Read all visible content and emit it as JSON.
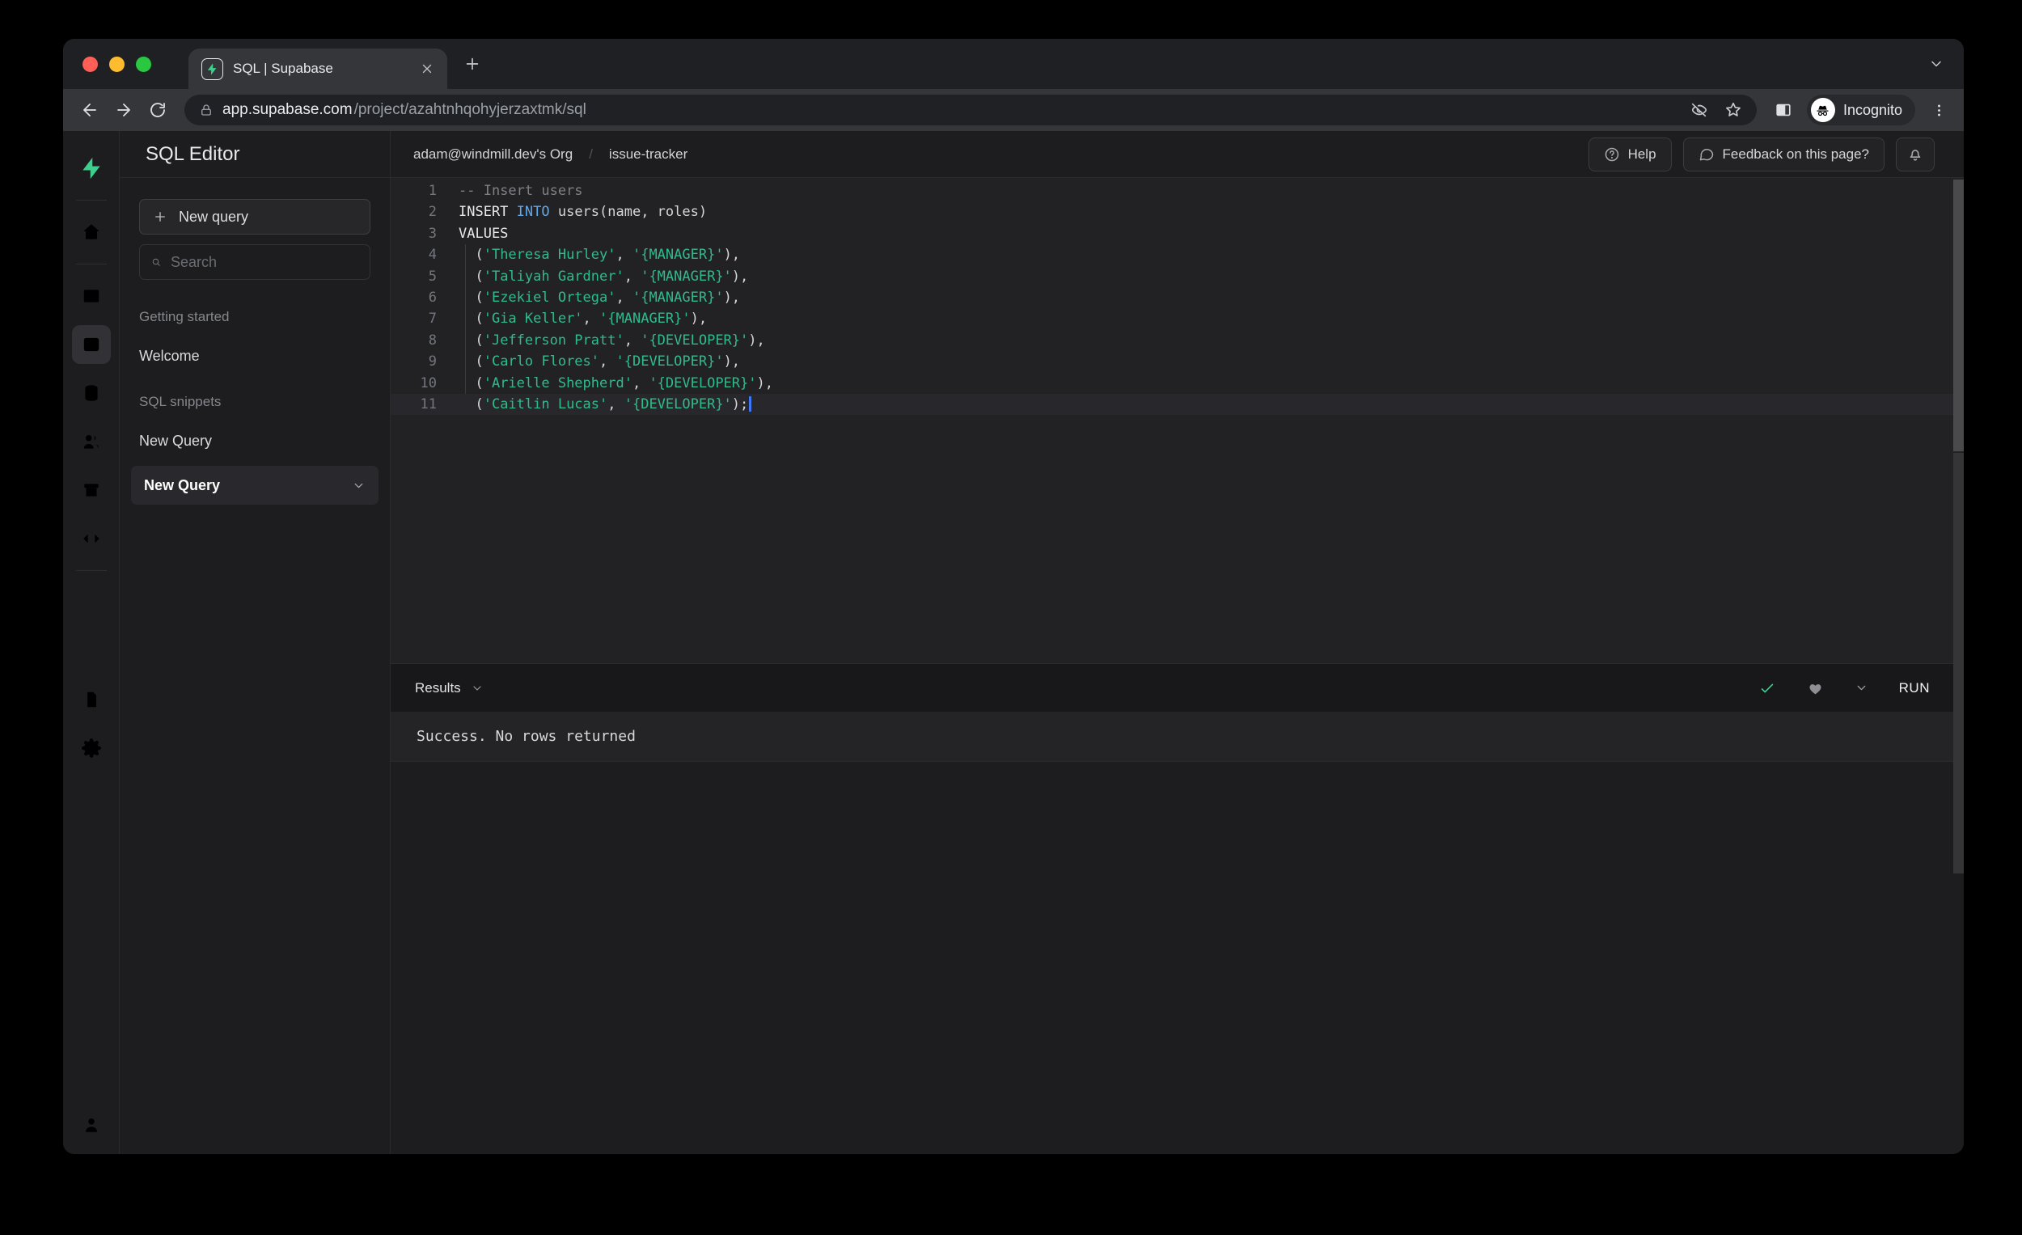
{
  "colors": {
    "brand_green": "#3ecf8e",
    "keyword_blue": "#61a8e8",
    "string_green": "#2fbc8b",
    "success_check": "#3ecf8e",
    "cursor_blue": "#3e78f2"
  },
  "browser": {
    "tab": {
      "title": "SQL | Supabase"
    },
    "url": {
      "host": "app.supabase.com",
      "path": "/project/azahtnhqohyjerzaxtmk/sql"
    },
    "incognito_label": "Incognito"
  },
  "header": {
    "app_title": "SQL Editor",
    "breadcrumb": {
      "org": "adam@windmill.dev's Org",
      "separator": "/",
      "project": "issue-tracker"
    },
    "help_label": "Help",
    "feedback_label": "Feedback on this page?"
  },
  "rail": {
    "logo": {
      "name": "supabase-logo",
      "icon": "supabase-logo-icon"
    },
    "groups": [
      {
        "items": [
          {
            "name": "home",
            "icon": "home-icon"
          }
        ]
      },
      {
        "items": [
          {
            "name": "table-editor",
            "icon": "table-editor-icon"
          },
          {
            "name": "sql-editor",
            "icon": "sql-editor-icon",
            "active": true
          },
          {
            "name": "database",
            "icon": "database-icon"
          },
          {
            "name": "authentication",
            "icon": "auth-users-icon"
          },
          {
            "name": "storage",
            "icon": "storage-icon"
          },
          {
            "name": "edge-functions",
            "icon": "code-icon"
          }
        ]
      },
      {
        "items": [
          {
            "name": "reports",
            "icon": "bar-chart-icon"
          },
          {
            "name": "logs",
            "icon": "list-icon"
          },
          {
            "name": "api-docs",
            "icon": "file-text-icon"
          },
          {
            "name": "project-settings",
            "icon": "gear-icon"
          }
        ]
      }
    ],
    "bottom": [
      {
        "name": "account",
        "icon": "user-icon"
      }
    ]
  },
  "sidebar": {
    "new_query_button": "New query",
    "search_placeholder": "Search",
    "sections": [
      {
        "label": "Getting started",
        "items": [
          {
            "label": "Welcome"
          }
        ]
      },
      {
        "label": "SQL snippets",
        "items": [
          {
            "label": "New Query"
          },
          {
            "label": "New Query",
            "active": true
          }
        ]
      }
    ]
  },
  "editor": {
    "lines": [
      {
        "n": 1,
        "tokens": [
          [
            "cm",
            "-- Insert users"
          ]
        ]
      },
      {
        "n": 2,
        "tokens": [
          [
            "kw",
            "INSERT "
          ],
          [
            "kw2",
            "INTO"
          ],
          [
            "pl",
            " users(name, roles)"
          ]
        ]
      },
      {
        "n": 3,
        "tokens": [
          [
            "kw",
            "VALUES"
          ]
        ]
      },
      {
        "n": 4,
        "guide": true,
        "tokens": [
          [
            "pl",
            "  ("
          ],
          [
            "str",
            "'Theresa Hurley'"
          ],
          [
            "pl",
            ", "
          ],
          [
            "str",
            "'{MANAGER}'"
          ],
          [
            "pl",
            "),"
          ]
        ]
      },
      {
        "n": 5,
        "guide": true,
        "tokens": [
          [
            "pl",
            "  ("
          ],
          [
            "str",
            "'Taliyah Gardner'"
          ],
          [
            "pl",
            ", "
          ],
          [
            "str",
            "'{MANAGER}'"
          ],
          [
            "pl",
            "),"
          ]
        ]
      },
      {
        "n": 6,
        "guide": true,
        "tokens": [
          [
            "pl",
            "  ("
          ],
          [
            "str",
            "'Ezekiel Ortega'"
          ],
          [
            "pl",
            ", "
          ],
          [
            "str",
            "'{MANAGER}'"
          ],
          [
            "pl",
            "),"
          ]
        ]
      },
      {
        "n": 7,
        "guide": true,
        "tokens": [
          [
            "pl",
            "  ("
          ],
          [
            "str",
            "'Gia Keller'"
          ],
          [
            "pl",
            ", "
          ],
          [
            "str",
            "'{MANAGER}'"
          ],
          [
            "pl",
            "),"
          ]
        ]
      },
      {
        "n": 8,
        "guide": true,
        "tokens": [
          [
            "pl",
            "  ("
          ],
          [
            "str",
            "'Jefferson Pratt'"
          ],
          [
            "pl",
            ", "
          ],
          [
            "str",
            "'{DEVELOPER}'"
          ],
          [
            "pl",
            "),"
          ]
        ]
      },
      {
        "n": 9,
        "guide": true,
        "tokens": [
          [
            "pl",
            "  ("
          ],
          [
            "str",
            "'Carlo Flores'"
          ],
          [
            "pl",
            ", "
          ],
          [
            "str",
            "'{DEVELOPER}'"
          ],
          [
            "pl",
            "),"
          ]
        ]
      },
      {
        "n": 10,
        "guide": true,
        "tokens": [
          [
            "pl",
            "  ("
          ],
          [
            "str",
            "'Arielle Shepherd'"
          ],
          [
            "pl",
            ", "
          ],
          [
            "str",
            "'{DEVELOPER}'"
          ],
          [
            "pl",
            "),"
          ]
        ]
      },
      {
        "n": 11,
        "current": true,
        "tokens": [
          [
            "pl",
            "  ("
          ],
          [
            "str",
            "'Caitlin Lucas'"
          ],
          [
            "pl",
            ", "
          ],
          [
            "str",
            "'{DEVELOPER}'"
          ],
          [
            "pl",
            ");"
          ]
        ]
      }
    ]
  },
  "results": {
    "label": "Results",
    "run_label": "RUN",
    "status": "Success. No rows returned"
  }
}
